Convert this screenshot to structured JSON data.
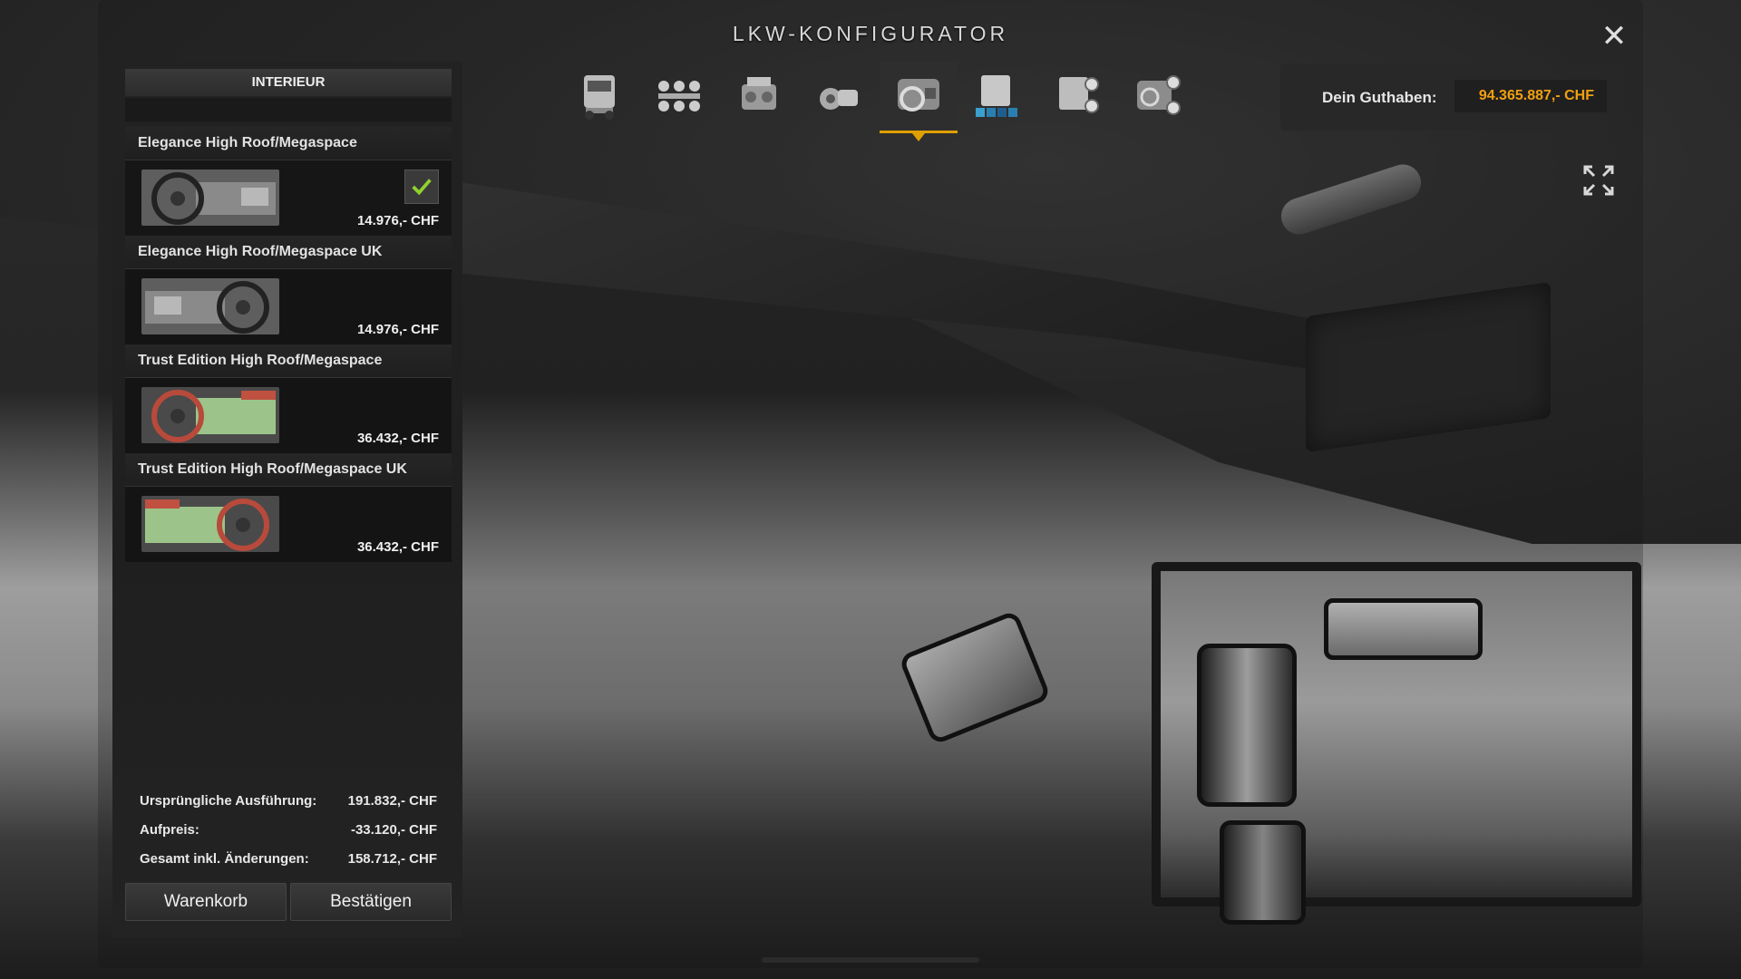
{
  "window": {
    "title": "LKW-KONFIGURATOR",
    "close_symbol": "✕"
  },
  "tabs": [
    {
      "name": "truck",
      "icon": "truck-front-icon",
      "active": false
    },
    {
      "name": "chassis",
      "icon": "chassis-icon",
      "active": false
    },
    {
      "name": "engine",
      "icon": "engine-icon",
      "active": false
    },
    {
      "name": "transmission",
      "icon": "transmission-icon",
      "active": false
    },
    {
      "name": "interior",
      "icon": "interior-icon",
      "active": true
    },
    {
      "name": "paint",
      "icon": "truck-paint-icon",
      "active": false
    },
    {
      "name": "accessories",
      "icon": "truck-accessories-icon",
      "active": false
    },
    {
      "name": "interior-accessories",
      "icon": "interior-accessories-icon",
      "active": false
    }
  ],
  "balance": {
    "label": "Dein Guthaben:",
    "value": "94.365.887,- CHF",
    "value_color": "#f0a010"
  },
  "panel": {
    "heading": "INTERIEUR",
    "items": [
      {
        "title": "Elegance High Roof/Megaspace",
        "price": "14.976,- CHF",
        "selected": true,
        "thumb": "grey-dashboard-left"
      },
      {
        "title": "Elegance High Roof/Megaspace UK",
        "price": "14.976,- CHF",
        "selected": false,
        "thumb": "grey-dashboard-right"
      },
      {
        "title": "Trust Edition High Roof/Megaspace",
        "price": "36.432,- CHF",
        "selected": false,
        "thumb": "green-red-dashboard-left"
      },
      {
        "title": "Trust Edition High Roof/Megaspace UK",
        "price": "36.432,- CHF",
        "selected": false,
        "thumb": "green-red-dashboard-right"
      }
    ]
  },
  "summary": {
    "original_label": "Ursprüngliche Ausführung:",
    "original_value": "191.832,- CHF",
    "surcharge_label": "Aufpreis:",
    "surcharge_value": "-33.120,- CHF",
    "total_label": "Gesamt inkl. Änderungen:",
    "total_value": "158.712,- CHF"
  },
  "buttons": {
    "cart": "Warenkorb",
    "confirm": "Bestätigen"
  },
  "colors": {
    "accent": "#e0a000",
    "check": "#8fd12e"
  }
}
